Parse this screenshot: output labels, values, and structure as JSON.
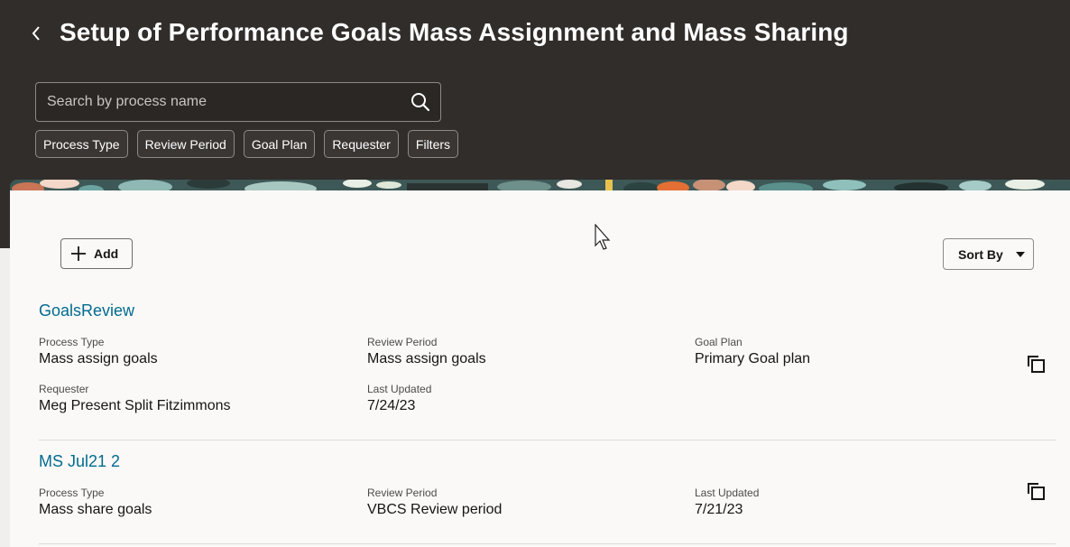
{
  "header": {
    "title": "Setup of Performance Goals Mass Assignment and Mass Sharing",
    "search_placeholder": "Search by process name",
    "chips": [
      "Process Type",
      "Review Period",
      "Goal Plan",
      "Requester",
      "Filters"
    ]
  },
  "toolbar": {
    "add_label": "Add",
    "sort_label": "Sort By"
  },
  "records": [
    {
      "title": "GoalsReview",
      "fields": [
        {
          "label": "Process Type",
          "value": "Mass assign goals"
        },
        {
          "label": "Review Period",
          "value": "Mass assign goals"
        },
        {
          "label": "Goal Plan",
          "value": "Primary Goal plan"
        },
        {
          "label": "Requester",
          "value": "Meg Present Split Fitzimmons"
        },
        {
          "label": "Last Updated",
          "value": "7/24/23"
        }
      ]
    },
    {
      "title": "MS Jul21 2",
      "fields": [
        {
          "label": "Process Type",
          "value": "Mass share goals"
        },
        {
          "label": "Review Period",
          "value": "VBCS Review period"
        },
        {
          "label": "Last Updated",
          "value": "7/21/23"
        }
      ]
    }
  ],
  "colors": {
    "header_bg": "#312d2a",
    "link": "#006b8f",
    "panel_bg": "#fbf9f8"
  },
  "icons": [
    "chevron-left-icon",
    "search-icon",
    "plus-icon",
    "caret-down-icon",
    "copy-icon",
    "mouse-pointer-icon"
  ]
}
